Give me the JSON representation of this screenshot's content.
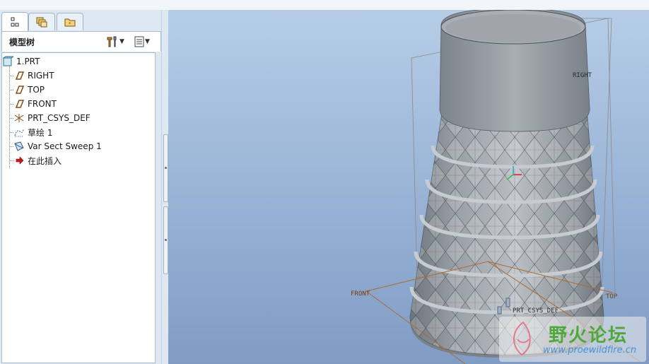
{
  "tabs": [
    {
      "name": "model-tree-tab",
      "icon": "tree-icon"
    },
    {
      "name": "layers-tab",
      "icon": "layers-icon"
    },
    {
      "name": "folder-tab",
      "icon": "folder-icon"
    }
  ],
  "panel": {
    "title": "模型树",
    "settings_icon": "tools-icon",
    "show_icon": "list-icon"
  },
  "tree": {
    "root": "1.PRT",
    "items": [
      {
        "label": "RIGHT",
        "icon": "datum-plane-icon"
      },
      {
        "label": "TOP",
        "icon": "datum-plane-icon"
      },
      {
        "label": "FRONT",
        "icon": "datum-plane-icon"
      },
      {
        "label": "PRT_CSYS_DEF",
        "icon": "coordinate-system-icon"
      },
      {
        "label": "草绘 1",
        "icon": "sketch-icon"
      },
      {
        "label": "Var Sect Sweep 1",
        "icon": "sweep-icon"
      },
      {
        "label": "在此插入",
        "icon": "insert-arrow-icon"
      }
    ]
  },
  "viewport": {
    "datum_labels": {
      "right": "RIGHT",
      "front": "FRONT",
      "top": "TOP",
      "csys": "PRT_CSYS_DEF"
    },
    "colors": {
      "datum": "#b06a2e",
      "model": "#8f969e",
      "accent": "#4fa83a"
    }
  },
  "watermark": {
    "cn": "野火论坛",
    "url": "www.proewildfire.cn"
  }
}
